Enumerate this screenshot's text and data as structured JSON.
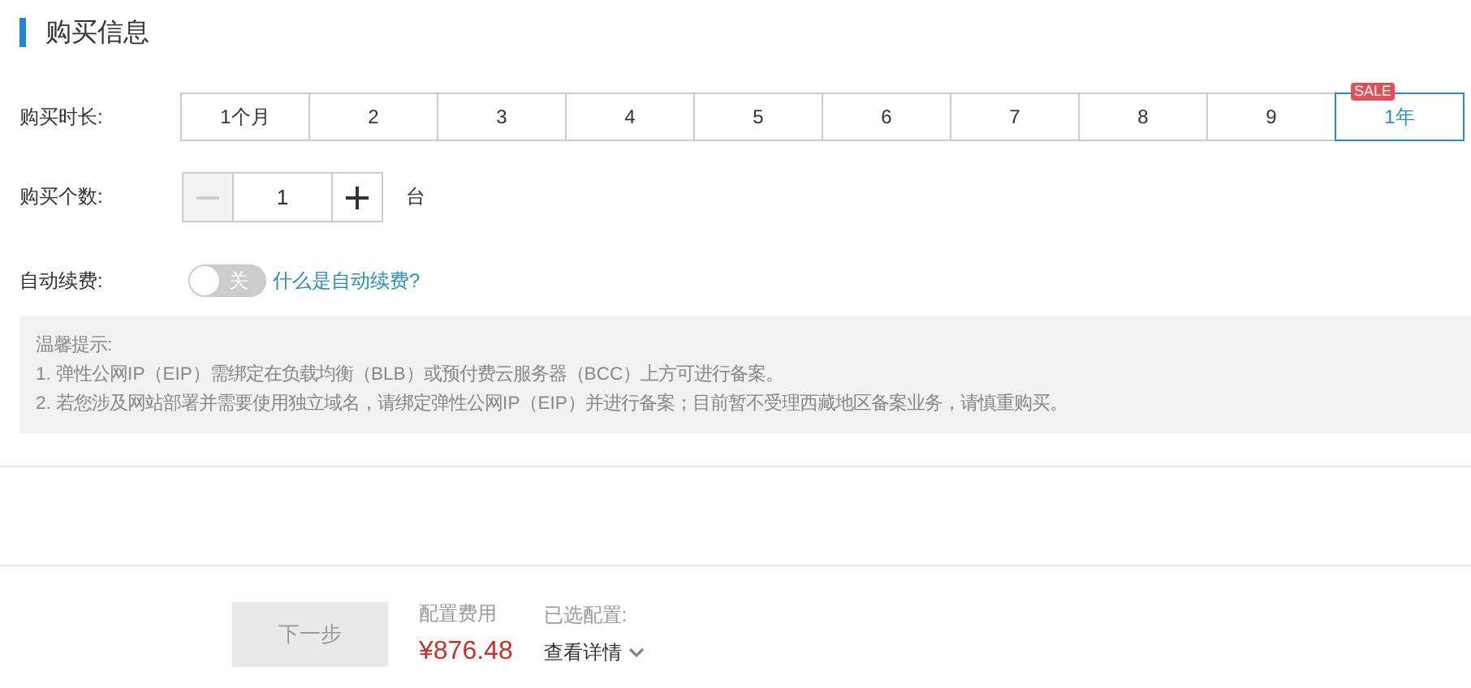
{
  "section": {
    "title": "购买信息"
  },
  "duration": {
    "label": "购买时长:",
    "options": [
      {
        "label": "1个月",
        "selected": false
      },
      {
        "label": "2",
        "selected": false
      },
      {
        "label": "3",
        "selected": false
      },
      {
        "label": "4",
        "selected": false
      },
      {
        "label": "5",
        "selected": false
      },
      {
        "label": "6",
        "selected": false
      },
      {
        "label": "7",
        "selected": false
      },
      {
        "label": "8",
        "selected": false
      },
      {
        "label": "9",
        "selected": false
      },
      {
        "label": "1年",
        "selected": true,
        "badge": "SALE"
      }
    ]
  },
  "quantity": {
    "label": "购买个数:",
    "minus_disabled": true,
    "value": "1",
    "unit": "台"
  },
  "auto_renew": {
    "label": "自动续费:",
    "on": false,
    "switch_text": "关",
    "help_link": "什么是自动续费?"
  },
  "notice": {
    "title": "温馨提示:",
    "lines": [
      "1. 弹性公网IP（EIP）需绑定在负载均衡（BLB）或预付费云服务器（BCC）上方可进行备案。",
      "2. 若您涉及网站部署并需要使用独立域名，请绑定弹性公网IP（EIP）并进行备案；目前暂不受理西藏地区备案业务，请慎重购买。"
    ]
  },
  "footer": {
    "next_button": {
      "label": "下一步",
      "disabled": true
    },
    "cost_label": "配置费用",
    "price": "¥876.48",
    "config_label": "已选配置:",
    "details_link": "查看详情"
  }
}
